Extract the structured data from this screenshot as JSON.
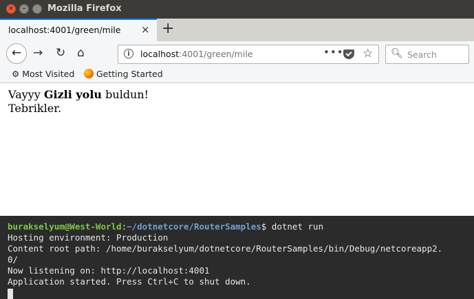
{
  "window": {
    "title": "Mozilla Firefox"
  },
  "tab": {
    "title": "localhost:4001/green/mile",
    "close_glyph": "×",
    "new_glyph": "+"
  },
  "nav": {
    "url_host": "localhost",
    "url_rest": ":4001/green/mile",
    "search_placeholder": "Search"
  },
  "bookmarks": [
    {
      "label": "Most Visited"
    },
    {
      "label": "Getting Started"
    }
  ],
  "page": {
    "line1_pre": "Vayyy ",
    "line1_bold": "Gizli yolu",
    "line1_post": " buldun!",
    "line2": "Tebrikler."
  },
  "terminal": {
    "user": "burakselyum@West-World",
    "path": "~/dotnetcore/RouterSamples",
    "command": "$ dotnet run",
    "lines": [
      "Hosting environment: Production",
      "Content root path: /home/burakselyum/dotnetcore/RouterSamples/bin/Debug/netcoreapp2.",
      "0/",
      "Now listening on: http://localhost:4001",
      "Application started. Press Ctrl+C to shut down."
    ]
  }
}
